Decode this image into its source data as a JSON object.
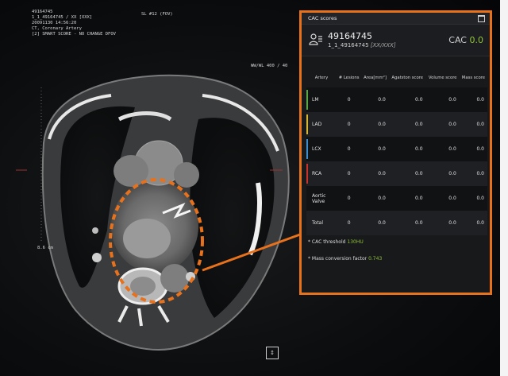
{
  "viewer": {
    "top_info": [
      "49164745",
      "1_1_49164745 / XX [XXX]",
      "20091130 14:56:20",
      "CT, Coronary Artery",
      "[2] SMART SCORE - NO CHANGE DFOV"
    ],
    "slice_label": "SL #12 (FOV)",
    "window_label": "WW/WL 400 / 40",
    "scale_label": "8.6 cm",
    "nav_glyph": "↕"
  },
  "panel": {
    "title": "CAC scores",
    "patient_id": "49164745",
    "patient_series": "1_1_49164745",
    "patient_suffix": "[XX/XXX]",
    "cac_label": "CAC",
    "cac_value": "0.0",
    "columns": [
      "Artery",
      "# Lesions",
      "Area[mm²]",
      "Agatston score",
      "Volume score",
      "Mass score"
    ],
    "rows": [
      {
        "artery": "LM",
        "color": "#5aa845",
        "lesions": "0",
        "area": "0.0",
        "agatston": "0.0",
        "volume": "0.0",
        "mass": "0.0"
      },
      {
        "artery": "LAD",
        "color": "#d6b531",
        "lesions": "0",
        "area": "0.0",
        "agatston": "0.0",
        "volume": "0.0",
        "mass": "0.0"
      },
      {
        "artery": "LCX",
        "color": "#3b8ed0",
        "lesions": "0",
        "area": "0.0",
        "agatston": "0.0",
        "volume": "0.0",
        "mass": "0.0"
      },
      {
        "artery": "RCA",
        "color": "#c8322c",
        "lesions": "0",
        "area": "0.0",
        "agatston": "0.0",
        "volume": "0.0",
        "mass": "0.0"
      },
      {
        "artery": "Aortic Valve",
        "color": "",
        "lesions": "0",
        "area": "0.0",
        "agatston": "0.0",
        "volume": "0.0",
        "mass": "0.0"
      },
      {
        "artery": "Total",
        "color": "",
        "lesions": "0",
        "area": "0.0",
        "agatston": "0.0",
        "volume": "0.0",
        "mass": "0.0"
      }
    ],
    "threshold_label": "* CAC threshold",
    "threshold_value": "130HU",
    "mass_label": "* Mass conversion factor",
    "mass_value": "0.743"
  },
  "colors": {
    "accent_orange": "#e8711c",
    "score_green": "#8fc23b"
  }
}
